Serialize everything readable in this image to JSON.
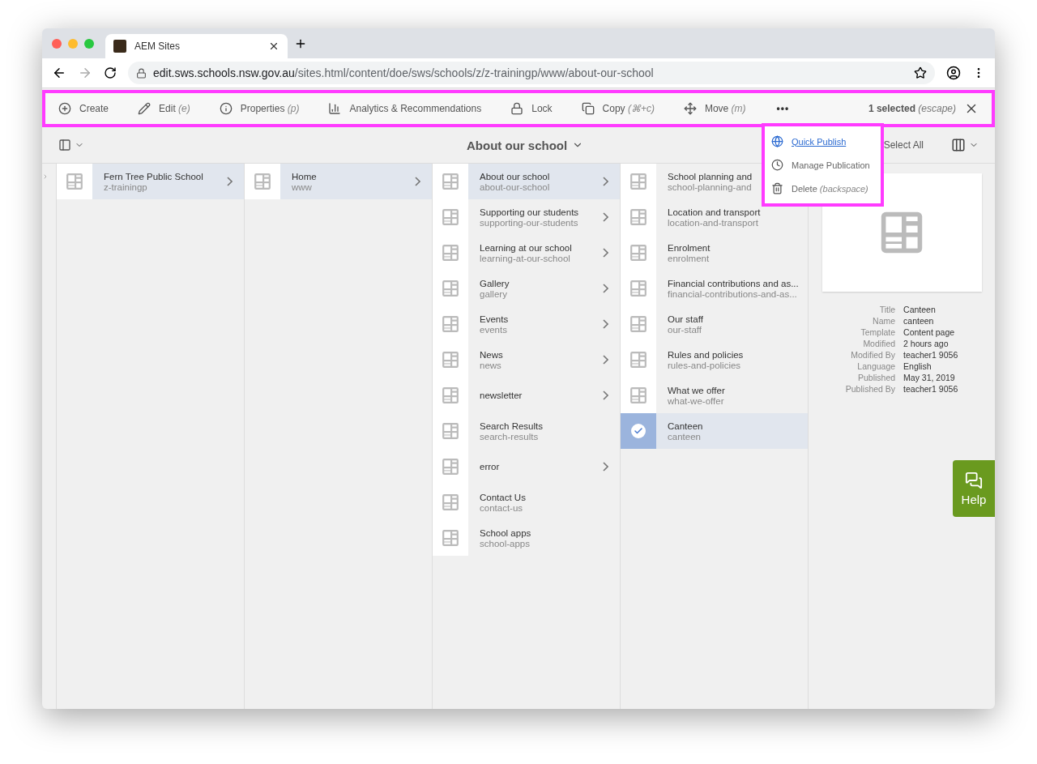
{
  "browser": {
    "tab_title": "AEM Sites",
    "url_host": "edit.sws.schools.nsw.gov.au",
    "url_path": "/sites.html/content/doe/sws/schools/z/z-trainingp/www/about-our-school"
  },
  "toolbar": {
    "highlighted": true,
    "actions": [
      {
        "kind": "create",
        "label": "Create"
      },
      {
        "kind": "edit",
        "label": "Edit",
        "shortcut": "(e)"
      },
      {
        "kind": "properties",
        "label": "Properties",
        "shortcut": "(p)"
      },
      {
        "kind": "analytics",
        "label": "Analytics & Recommendations"
      },
      {
        "kind": "lock",
        "label": "Lock"
      },
      {
        "kind": "copy",
        "label": "Copy",
        "shortcut": "(⌘+c)"
      },
      {
        "kind": "move",
        "label": "Move",
        "shortcut": "(m)"
      }
    ],
    "more": "•••",
    "selection": "1 selected",
    "selection_shortcut": "(escape)"
  },
  "menu": {
    "highlighted": true,
    "items": [
      {
        "kind": "publish",
        "label": "Quick Publish",
        "focused": true
      },
      {
        "kind": "manage",
        "label": "Manage Publication",
        "focused": false
      },
      {
        "kind": "delete",
        "label": "Delete",
        "shortcut": "(backspace)",
        "focused": false
      }
    ]
  },
  "header": {
    "title": "About our school",
    "select_all": "Select All"
  },
  "columns": [
    {
      "items": [
        {
          "title": "Fern Tree Public School",
          "name": "z-trainingp",
          "selected": true,
          "checked": false,
          "has_children": true
        }
      ]
    },
    {
      "items": [
        {
          "title": "Home",
          "name": "www",
          "selected": true,
          "checked": false,
          "has_children": true
        }
      ]
    },
    {
      "items": [
        {
          "title": "About our school",
          "name": "about-our-school",
          "selected": true,
          "checked": false,
          "has_children": true
        },
        {
          "title": "Supporting our students",
          "name": "supporting-our-students",
          "selected": false,
          "checked": false,
          "has_children": true
        },
        {
          "title": "Learning at our school",
          "name": "learning-at-our-school",
          "selected": false,
          "checked": false,
          "has_children": true
        },
        {
          "title": "Gallery",
          "name": "gallery",
          "selected": false,
          "checked": false,
          "has_children": true
        },
        {
          "title": "Events",
          "name": "events",
          "selected": false,
          "checked": false,
          "has_children": true
        },
        {
          "title": "News",
          "name": "news",
          "selected": false,
          "checked": false,
          "has_children": true
        },
        {
          "title": "newsletter",
          "selected": false,
          "checked": false,
          "has_children": true
        },
        {
          "title": "Search Results",
          "name": "search-results",
          "selected": false,
          "checked": false,
          "has_children": false
        },
        {
          "title": "error",
          "selected": false,
          "checked": false,
          "has_children": true
        },
        {
          "title": "Contact Us",
          "name": "contact-us",
          "selected": false,
          "checked": false,
          "has_children": false
        },
        {
          "title": "School apps",
          "name": "school-apps",
          "selected": false,
          "checked": false,
          "has_children": false
        }
      ]
    },
    {
      "items": [
        {
          "title": "School planning and",
          "name": "school-planning-and",
          "selected": false,
          "checked": false,
          "has_children": false
        },
        {
          "title": "Location and transport",
          "name": "location-and-transport",
          "selected": false,
          "checked": false,
          "has_children": false
        },
        {
          "title": "Enrolment",
          "name": "enrolment",
          "selected": false,
          "checked": false,
          "has_children": false
        },
        {
          "title": "Financial contributions and as...",
          "name": "financial-contributions-and-as...",
          "selected": false,
          "checked": false,
          "has_children": false
        },
        {
          "title": "Our staff",
          "name": "our-staff",
          "selected": false,
          "checked": false,
          "has_children": false
        },
        {
          "title": "Rules and policies",
          "name": "rules-and-policies",
          "selected": false,
          "checked": false,
          "has_children": false
        },
        {
          "title": "What we offer",
          "name": "what-we-offer",
          "selected": false,
          "checked": false,
          "has_children": false
        },
        {
          "title": "Canteen",
          "name": "canteen",
          "selected": true,
          "checked": true,
          "has_children": false
        }
      ]
    }
  ],
  "preview": {
    "properties": [
      {
        "label": "Title",
        "value": "Canteen"
      },
      {
        "label": "Name",
        "value": "canteen"
      },
      {
        "label": "Template",
        "value": "Content page"
      },
      {
        "label": "Modified",
        "value": "2 hours ago"
      },
      {
        "label": "Modified By",
        "value": "teacher1 9056"
      },
      {
        "label": "Language",
        "value": "English"
      },
      {
        "label": "Published",
        "value": "May 31, 2019"
      },
      {
        "label": "Published By",
        "value": "teacher1 9056"
      }
    ]
  },
  "help": "Help"
}
